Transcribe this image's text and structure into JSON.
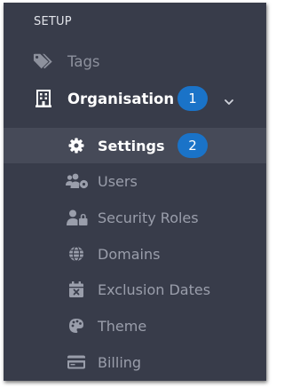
{
  "section": {
    "label": "SETUP"
  },
  "nav": {
    "tags": {
      "label": "Tags",
      "icon": "tags-icon"
    },
    "organisation": {
      "label": "Organisation",
      "icon": "building-icon",
      "badge": "1",
      "expand_icon": "chevron-down-icon"
    },
    "sub_items": [
      {
        "label": "Settings",
        "icon": "gear-icon",
        "badge": "2",
        "active": true
      },
      {
        "label": "Users",
        "icon": "users-cog-icon"
      },
      {
        "label": "Security Roles",
        "icon": "user-lock-icon"
      },
      {
        "label": "Domains",
        "icon": "globe-icon"
      },
      {
        "label": "Exclusion Dates",
        "icon": "calendar-times-icon"
      },
      {
        "label": "Theme",
        "icon": "palette-icon"
      },
      {
        "label": "Billing",
        "icon": "credit-card-icon"
      }
    ]
  },
  "colors": {
    "panel_bg": "#383c4a",
    "active_bg": "#464a58",
    "badge": "#1a73c8",
    "muted_text": "#9a9eab",
    "active_text": "#ffffff"
  }
}
